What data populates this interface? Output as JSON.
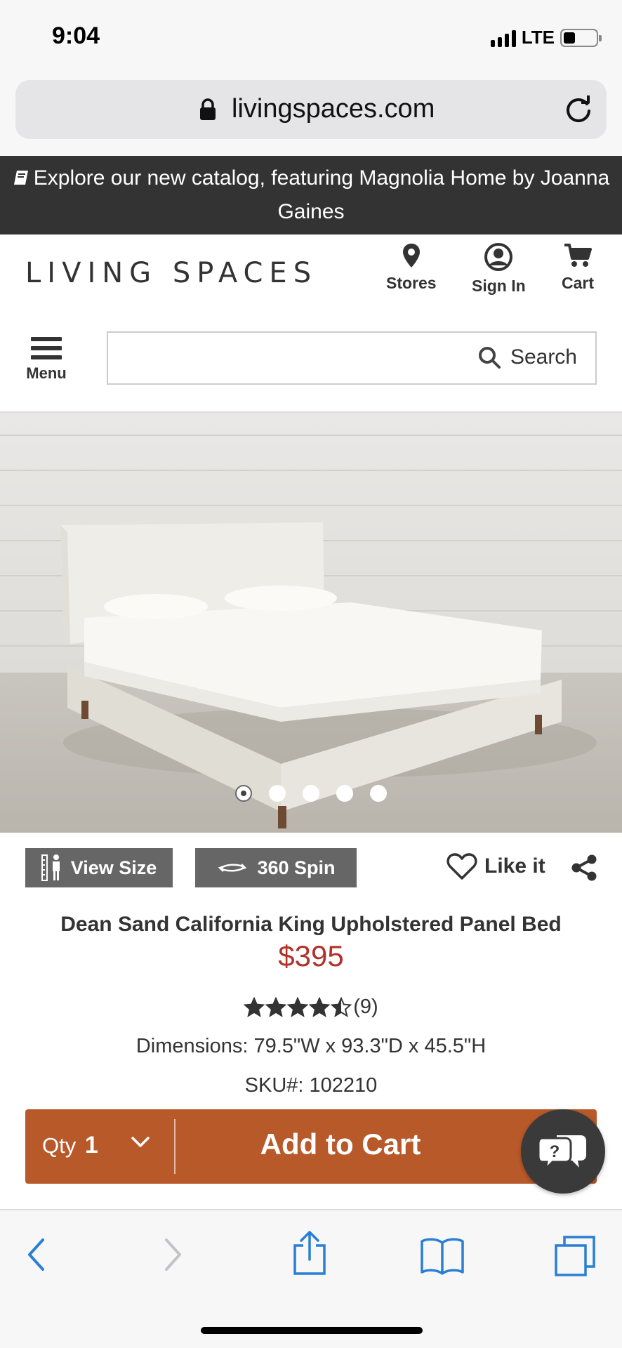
{
  "status": {
    "time": "9:04",
    "network": "LTE"
  },
  "browser": {
    "url": "livingspaces.com"
  },
  "banner": {
    "text": "Explore our new catalog, featuring Magnolia Home by Joanna Gaines"
  },
  "header": {
    "logo": "LIVING SPACES",
    "stores_label": "Stores",
    "signin_label": "Sign In",
    "cart_label": "Cart"
  },
  "nav": {
    "menu_label": "Menu",
    "search_label": "Search"
  },
  "gallery": {
    "image_count": 5,
    "active_index": 0
  },
  "actions": {
    "view_size_label": "View Size",
    "spin_label": "360 Spin",
    "like_label": "Like it"
  },
  "product": {
    "title": "Dean Sand California King Upholstered Panel Bed",
    "price": "$395",
    "rating": 4.5,
    "review_count": "(9)",
    "dimensions": "Dimensions: 79.5\"W x 93.3\"D x 45.5\"H",
    "sku": "SKU#: 102210"
  },
  "cart": {
    "qty_label": "Qty",
    "qty_value": "1",
    "add_label": "Add to Cart"
  },
  "colors": {
    "accent": "#b8592a",
    "price": "#b0322b",
    "banner_bg": "#333333",
    "ios_blue": "#2a7fd4"
  }
}
